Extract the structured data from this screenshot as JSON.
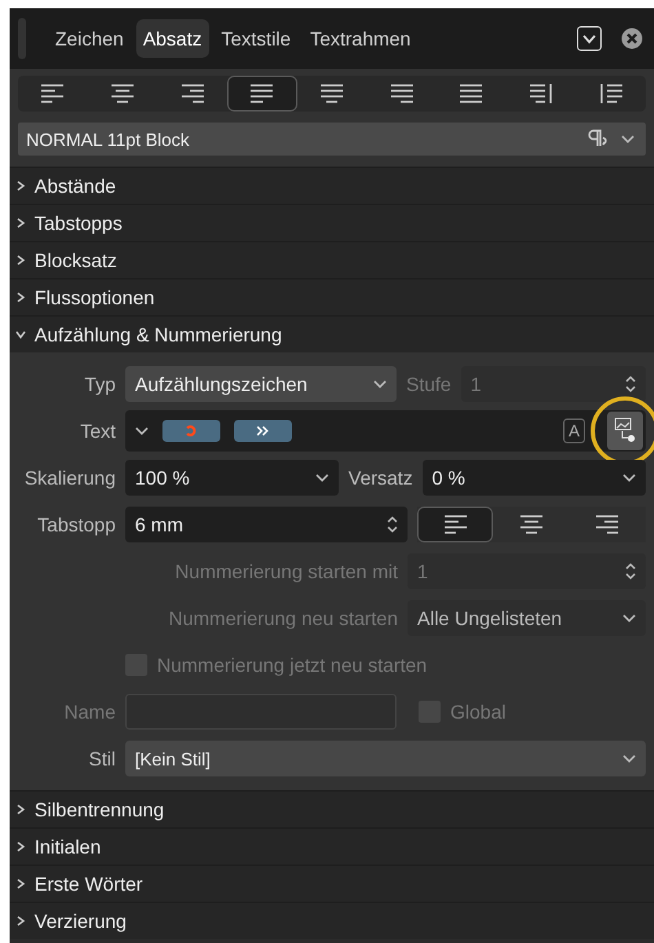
{
  "tabs": [
    {
      "label": "Zeichen",
      "selected": false
    },
    {
      "label": "Absatz",
      "selected": true
    },
    {
      "label": "Textstile",
      "selected": false
    },
    {
      "label": "Textrahmen",
      "selected": false
    }
  ],
  "alignment": [
    {
      "kind": "left",
      "selected": false
    },
    {
      "kind": "center",
      "selected": false
    },
    {
      "kind": "right",
      "selected": false
    },
    {
      "kind": "justify-left",
      "selected": true
    },
    {
      "kind": "justify-center",
      "selected": false
    },
    {
      "kind": "justify-right",
      "selected": false
    },
    {
      "kind": "justify-all",
      "selected": false
    },
    {
      "kind": "towards-spine",
      "selected": false
    },
    {
      "kind": "away-spine",
      "selected": false
    }
  ],
  "paragraph_style": {
    "value": "NORMAL 11pt Block"
  },
  "sections": [
    {
      "label": "Abstände",
      "expanded": false
    },
    {
      "label": "Tabstopps",
      "expanded": false
    },
    {
      "label": "Blocksatz",
      "expanded": false
    },
    {
      "label": "Flussoptionen",
      "expanded": false
    },
    {
      "label": "Aufzählung & Nummerierung",
      "expanded": true
    },
    {
      "label": "Silbentrennung",
      "expanded": false
    },
    {
      "label": "Initialen",
      "expanded": false
    },
    {
      "label": "Erste Wörter",
      "expanded": false
    },
    {
      "label": "Verzierung",
      "expanded": false
    }
  ],
  "bullets": {
    "type": {
      "label": "Typ",
      "value": "Aufzählungszeichen"
    },
    "level": {
      "label": "Stufe",
      "value": "1",
      "disabled": true
    },
    "text": {
      "label": "Text",
      "glyph_button": "A"
    },
    "scaling": {
      "label": "Skalierung",
      "value": "100 %"
    },
    "offset": {
      "label": "Versatz",
      "value": "0 %"
    },
    "tab_stop": {
      "label": "Tabstopp",
      "value": "6 mm",
      "alignment": [
        {
          "kind": "left",
          "selected": true
        },
        {
          "kind": "center",
          "selected": false
        },
        {
          "kind": "right",
          "selected": false
        }
      ]
    },
    "start_with": {
      "label": "Nummerierung starten mit",
      "value": "1",
      "disabled": true
    },
    "restart": {
      "label": "Nummerierung neu starten",
      "value": "Alle Ungelisteten",
      "disabled": true
    },
    "restart_now": {
      "label": "Nummerierung jetzt neu starten",
      "checked": false,
      "disabled": true
    },
    "name": {
      "label": "Name",
      "disabled": true
    },
    "global": {
      "label": "Global",
      "checked": false,
      "disabled": true
    },
    "style": {
      "label": "Stil",
      "value": "[Kein Stil]"
    }
  }
}
